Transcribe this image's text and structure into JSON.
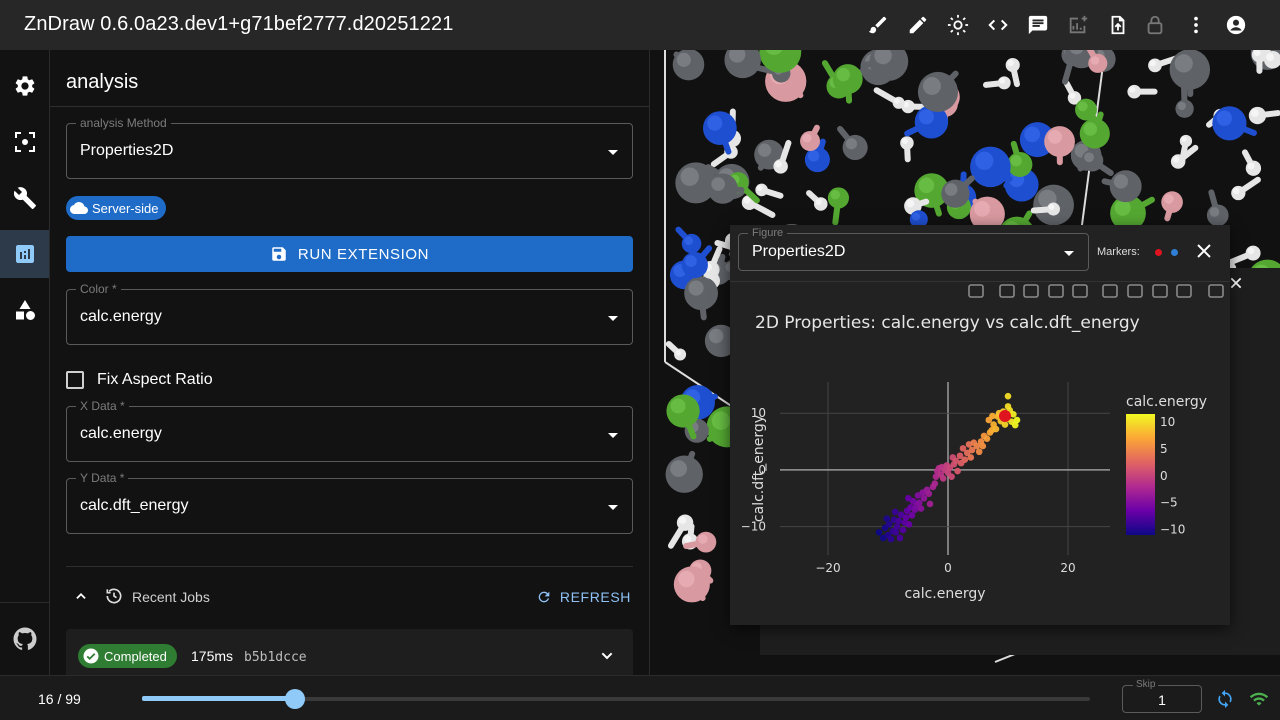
{
  "app": {
    "title": "ZnDraw 0.6.0a23.dev1+g71bef2777.d20251221"
  },
  "toolbar": {
    "icons": [
      "brush-icon",
      "pencil-icon",
      "brightness-icon",
      "code-icon",
      "chat-icon",
      "add-chart-icon",
      "upload-file-icon",
      "lock-icon",
      "more-vert-icon",
      "account-icon"
    ]
  },
  "rail": {
    "items": [
      "settings-icon",
      "selection-icon",
      "build-icon",
      "analytics-icon",
      "shapes-icon"
    ],
    "footer": "github-icon",
    "active": "analytics-icon"
  },
  "panel": {
    "title": "analysis",
    "method": {
      "label": "analysis Method",
      "value": "Properties2D"
    },
    "chip": "Server-side",
    "run_label": "RUN EXTENSION",
    "color": {
      "label": "Color *",
      "value": "calc.energy"
    },
    "fix_aspect": {
      "label": "Fix Aspect Ratio",
      "checked": false
    },
    "x_data": {
      "label": "X Data *",
      "value": "calc.energy"
    },
    "y_data": {
      "label": "Y Data *",
      "value": "calc.dft_energy"
    },
    "jobs": {
      "title": "Recent Jobs",
      "refresh_label": "REFRESH",
      "items": [
        {
          "status": "Completed",
          "duration": "175ms",
          "id": "b5b1dcce"
        }
      ]
    }
  },
  "figure": {
    "select_label": "Figure",
    "select_value": "Properties2D",
    "markers_label": "Markers:",
    "marker_colors": [
      "#e0141e",
      "#2f7fd6"
    ],
    "modebar": [
      "camera-icon",
      "zoom-icon",
      "pan-icon",
      "box-select-icon",
      "lasso-icon",
      "zoom-in-icon",
      "zoom-out-icon",
      "autoscale-icon",
      "reset-home-icon",
      "plotly-logo-icon"
    ]
  },
  "chart_data": {
    "type": "scatter",
    "title": "2D Properties: calc.energy vs calc.dft_energy",
    "xlabel": "calc.energy",
    "ylabel": "calc.dft_energy",
    "xlim": [
      -28,
      27
    ],
    "ylim": [
      -15,
      15.5
    ],
    "xticks": [
      -20,
      0,
      20
    ],
    "xtick_labels": [
      "−20",
      "0",
      "20"
    ],
    "yticks": [
      -10,
      0,
      10
    ],
    "ytick_labels": [
      "−10",
      "0",
      "10"
    ],
    "colorbar": {
      "title": "calc.energy",
      "ticks": [
        10,
        5,
        0,
        -5,
        -10
      ],
      "tick_labels": [
        "10",
        "5",
        "0",
        "−5",
        "−10"
      ],
      "range": [
        -11,
        11.5
      ]
    },
    "colorscale": [
      "#0d0887",
      "#6a00a8",
      "#b12a90",
      "#e16462",
      "#fca636",
      "#f0f921"
    ],
    "selected_point": {
      "x": 9.5,
      "y": 9.5,
      "color": "#e0141e"
    },
    "points": [
      [
        -11.5,
        -11.0
      ],
      [
        -10.8,
        -12.0
      ],
      [
        -10.5,
        -10.2
      ],
      [
        -10.0,
        -11.5
      ],
      [
        -9.8,
        -9.6
      ],
      [
        -9.5,
        -12.2
      ],
      [
        -9.2,
        -10.8
      ],
      [
        -9.0,
        -8.8
      ],
      [
        -8.7,
        -11.0
      ],
      [
        -8.5,
        -10.0
      ],
      [
        -8.2,
        -9.0
      ],
      [
        -8.0,
        -12.0
      ],
      [
        -7.8,
        -7.9
      ],
      [
        -7.5,
        -10.6
      ],
      [
        -7.2,
        -9.3
      ],
      [
        -7.0,
        -8.4
      ],
      [
        -6.8,
        -7.2
      ],
      [
        -6.5,
        -9.6
      ],
      [
        -6.2,
        -6.6
      ],
      [
        -6.0,
        -8.0
      ],
      [
        -5.8,
        -5.5
      ],
      [
        -5.5,
        -7.0
      ],
      [
        -5.2,
        -6.2
      ],
      [
        -5.0,
        -4.5
      ],
      [
        -4.8,
        -5.8
      ],
      [
        -4.5,
        -6.8
      ],
      [
        -4.2,
        -4.0
      ],
      [
        -4.0,
        -5.0
      ],
      [
        -3.5,
        -3.5
      ],
      [
        -3.0,
        -6.0
      ],
      [
        -2.5,
        -3.0
      ],
      [
        -2.0,
        -1.2
      ],
      [
        -1.8,
        -0.2
      ],
      [
        -1.5,
        0.3
      ],
      [
        -1.2,
        -0.8
      ],
      [
        -1.0,
        0.5
      ],
      [
        -0.8,
        -1.5
      ],
      [
        -0.5,
        0.0
      ],
      [
        -0.2,
        0.8
      ],
      [
        0.0,
        -0.5
      ],
      [
        0.3,
        0.4
      ],
      [
        0.6,
        -1.2
      ],
      [
        0.8,
        2.2
      ],
      [
        1.0,
        1.0
      ],
      [
        1.3,
        1.6
      ],
      [
        1.6,
        -0.2
      ],
      [
        2.0,
        2.5
      ],
      [
        2.5,
        3.8
      ],
      [
        2.8,
        1.8
      ],
      [
        3.2,
        3.0
      ],
      [
        3.5,
        4.5
      ],
      [
        4.0,
        3.5
      ],
      [
        4.3,
        4.8
      ],
      [
        4.8,
        4.2
      ],
      [
        5.2,
        3.2
      ],
      [
        5.5,
        5.0
      ],
      [
        6.0,
        6.0
      ],
      [
        6.5,
        5.5
      ],
      [
        7.0,
        6.6
      ],
      [
        7.3,
        7.0
      ],
      [
        7.6,
        8.0
      ],
      [
        8.0,
        7.2
      ],
      [
        8.3,
        9.4
      ],
      [
        8.5,
        10.0
      ],
      [
        8.8,
        8.6
      ],
      [
        9.2,
        10.3
      ],
      [
        9.5,
        8.0
      ],
      [
        9.8,
        9.0
      ],
      [
        10.0,
        11.2
      ],
      [
        10.3,
        10.5
      ],
      [
        10.6,
        8.5
      ],
      [
        10.9,
        9.8
      ],
      [
        11.2,
        7.9
      ],
      [
        11.5,
        8.8
      ],
      [
        10.0,
        13.0
      ],
      [
        6.8,
        8.8
      ],
      [
        7.4,
        9.5
      ],
      [
        5.8,
        4.2
      ],
      [
        3.8,
        2.2
      ],
      [
        2.2,
        1.2
      ],
      [
        -2.2,
        -2.4
      ],
      [
        -3.2,
        -4.2
      ],
      [
        -6.6,
        -5.0
      ],
      [
        -8.8,
        -7.4
      ],
      [
        -10.2,
        -8.6
      ]
    ]
  }
}
